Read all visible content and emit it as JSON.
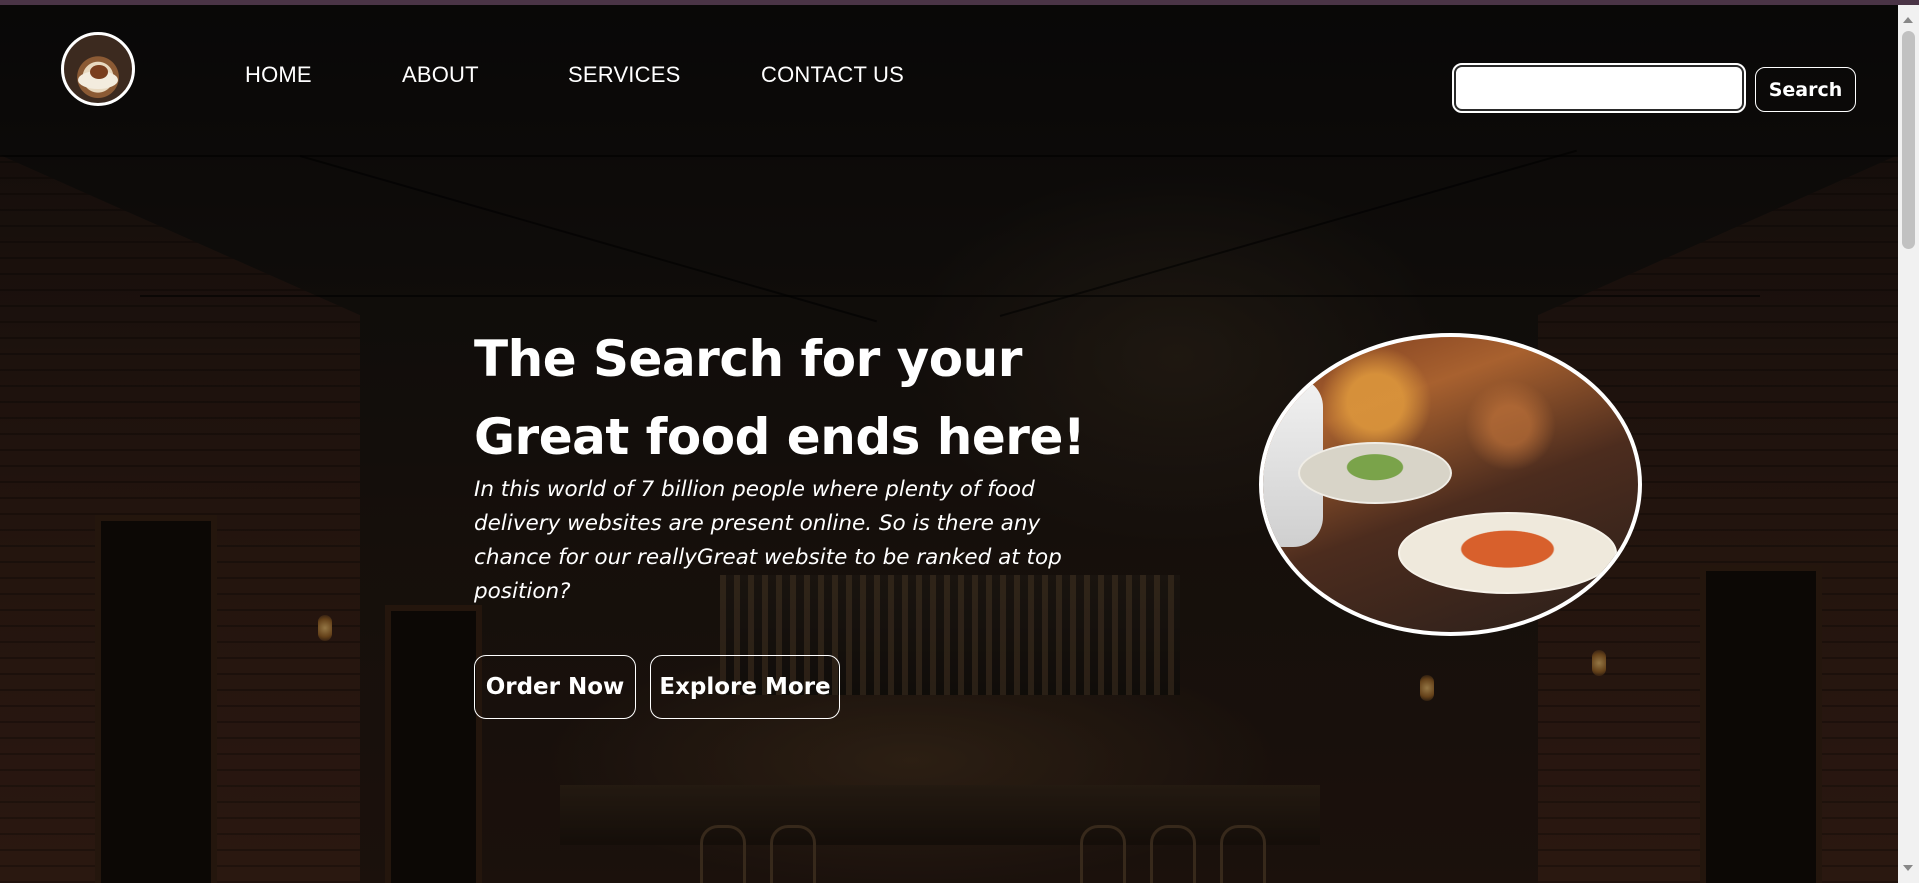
{
  "nav": {
    "items": [
      {
        "label": "HOME"
      },
      {
        "label": "ABOUT"
      },
      {
        "label": "SERVICES"
      },
      {
        "label": "CONTACT US"
      }
    ]
  },
  "search": {
    "placeholder": "",
    "value": "",
    "button_label": "Search"
  },
  "hero": {
    "title_line1": "The Search for your",
    "title_line2": "Great food ends here!",
    "description": "In this world of 7 billion people where plenty of food delivery websites are present online. So is there any chance for our reallyGreat website to be ranked at top position?",
    "buttons": {
      "order_now": "Order Now",
      "explore_more": "Explore More"
    }
  },
  "colors": {
    "text": "#ffffff",
    "accent_strip": "#4a3446",
    "search_input_bg": "#ffffff"
  },
  "icons": {
    "logo": "restaurant-dish-logo",
    "hero_image": "waiter-serving-dishes-photo"
  }
}
